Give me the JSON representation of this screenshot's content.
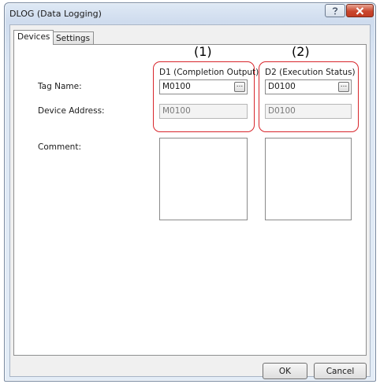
{
  "window": {
    "title": "DLOG (Data Logging)"
  },
  "tabs": [
    {
      "label": "Devices"
    },
    {
      "label": "Settings"
    }
  ],
  "labels": {
    "tag_name": "Tag Name:",
    "device_address": "Device Address:",
    "comment": "Comment:"
  },
  "columns": [
    {
      "marker": "(1)",
      "header": "D1 (Completion Output)",
      "tag_name": "M0100",
      "device_address": "M0100"
    },
    {
      "marker": "(2)",
      "header": "D2 (Execution Status)",
      "tag_name": "D0100",
      "device_address": "D0100"
    }
  ],
  "buttons": {
    "ok": "OK",
    "cancel": "Cancel",
    "browse": "..."
  },
  "icons": {
    "help": "question-mark-icon",
    "close": "close-x-icon"
  },
  "colors": {
    "highlight": "#d8262c",
    "close_button": "#c9472e"
  }
}
